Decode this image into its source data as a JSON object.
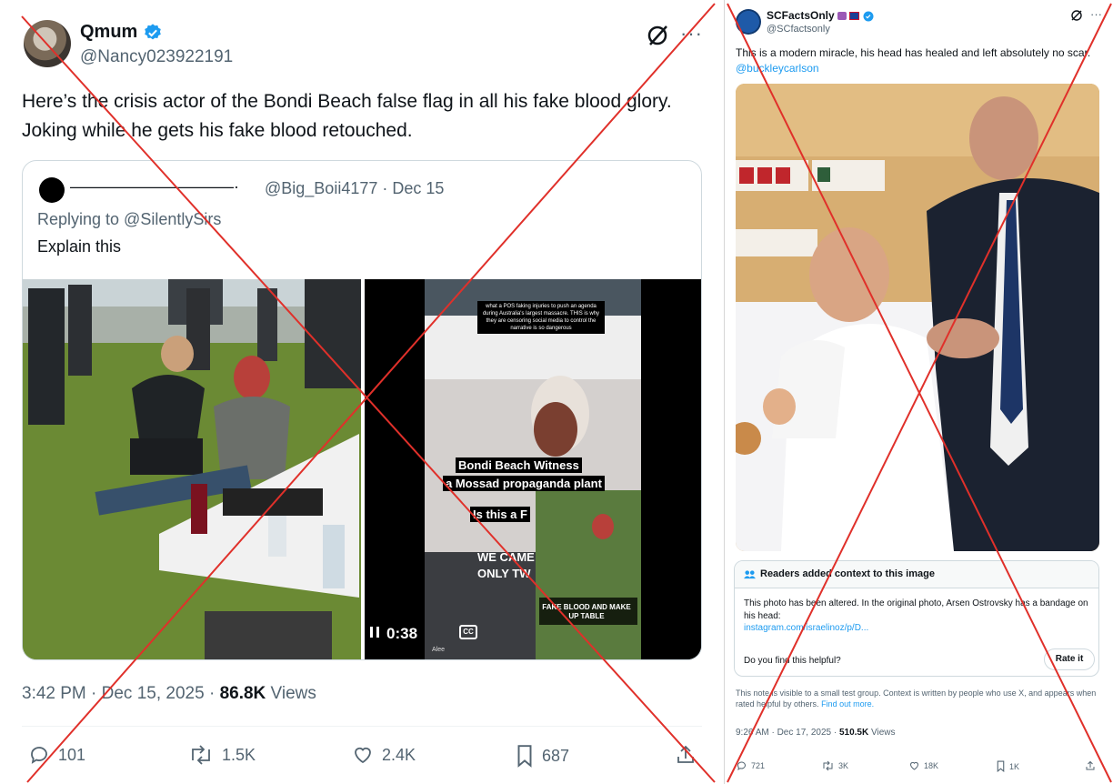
{
  "left_tweet": {
    "author_name": "Qmum",
    "author_handle": "@Nancy023922191",
    "text": "Here’s the crisis actor of the Bondi Beach false flag in all his fake blood glory.  Joking while he gets his fake blood retouched.",
    "quoted": {
      "author_name": "——————————·",
      "author_handle_date": "@Big_Boii4177 · Dec 15",
      "replying_to": "Replying to @SilentlySirs",
      "text": "Explain this",
      "video_time": "0:38",
      "video_overlay_caption_1": "Bondi Beach Witness",
      "video_overlay_caption_2": "a Mossad propaganda plant",
      "video_overlay_caption_3": "Is this a F",
      "video_overlay_caption_4": "WE CAME",
      "video_overlay_caption_5": "ONLY TW",
      "video_overlay_caption_6": "FAKE BLOOD AND MAKE UP TABLE",
      "video_overlay_top_text": "what a POS faking injuries to push an agenda during Australia's largest massacre. THIS is why they are censoring social media to control the narrative is so dangerous",
      "video_overlay_user": "Alee"
    },
    "time": "3:42 PM · Dec 15, 2025 · ",
    "views_count": "86.8K",
    "views_label": " Views",
    "actions": {
      "replies": "101",
      "reposts": "1.5K",
      "likes": "2.4K",
      "bookmarks": "687"
    }
  },
  "right_tweet": {
    "author_name": "SCFactsOnly",
    "author_handle": "@SCfactsonly",
    "text": "This is a modern miracle, his head has healed and left absolutely no scar.",
    "mention": "@buckleycarlson",
    "community_note": {
      "header": "Readers added context to this image",
      "body": "This photo has been altered. In the original photo, Arsen Ostrovsky has a bandage on his head:",
      "link": "instagram.com/israelinoz/p/D...",
      "helpful_prompt": "Do you find this helpful?",
      "rate_label": "Rate it"
    },
    "disclaimer": "This note is visible to a small test group. Context is written by people who use X, and appears when rated helpful by others. ",
    "disclaimer_link": "Find out more.",
    "time": "9:26 AM · Dec 17, 2025 · ",
    "views_count": "510.5K",
    "views_label": " Views",
    "actions": {
      "replies": "721",
      "reposts": "3K",
      "likes": "18K",
      "bookmarks": "1K"
    }
  },
  "colors": {
    "x_mark": "#e0302a",
    "verified": "#1d9bf0",
    "text": "#0f1419",
    "muted": "#536471"
  },
  "icons": [
    "grok-icon",
    "more-icon",
    "verified-icon",
    "reply-icon",
    "repost-icon",
    "like-icon",
    "bookmark-icon",
    "share-icon",
    "pause-icon",
    "cc-icon",
    "readers-icon"
  ]
}
